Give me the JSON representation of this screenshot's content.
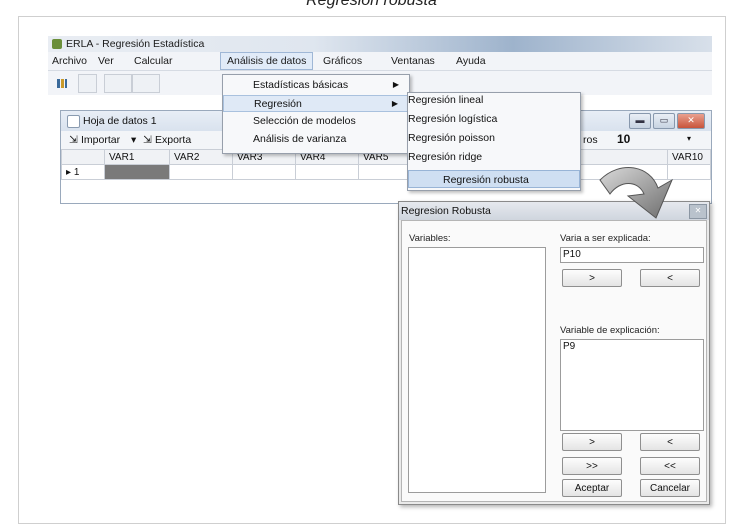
{
  "caption": "Regresión robusta",
  "app": {
    "title": "ERLA - Regresión Estadística",
    "menu": [
      "Archivo",
      "Ver",
      "Calcular",
      "Análisis de datos",
      "Gráficos",
      "Ventanas",
      "Ayuda"
    ],
    "active_menu_index": 3
  },
  "analysis_menu": {
    "items": [
      "Estadísticas básicas",
      "Regresión",
      "Selección de modelos",
      "Análisis de varianza"
    ],
    "highlighted_index": 1
  },
  "regression_submenu": {
    "items": [
      "Regresión lineal",
      "Regresión logística",
      "Regresión poisson",
      "Regresión ridge",
      "Regresión robusta"
    ],
    "highlighted_index": 4
  },
  "datasheet": {
    "title": "Hoja de datos 1",
    "import_label": "Importar",
    "export_label": "Exporta",
    "rows_label": "ros",
    "rows_value": "10",
    "columns": [
      "VAR1",
      "VAR2",
      "VAR3",
      "VAR4",
      "VAR5",
      "VAR10"
    ],
    "row_label": "1"
  },
  "dialog": {
    "title": "Regresion Robusta",
    "variables_label": "Variables:",
    "explained_label": "Varia    a ser explicada:",
    "explained_value": "P10",
    "explanatory_label": "Variable de explicación:",
    "explanatory_items": [
      "P9"
    ],
    "move_right": ">",
    "move_left": "<",
    "move_all_right": ">>",
    "move_all_left": "<<",
    "accept": "Aceptar",
    "cancel": "Cancelar"
  }
}
